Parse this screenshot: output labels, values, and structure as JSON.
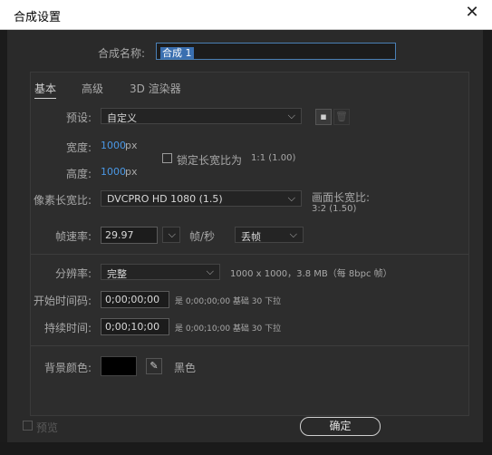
{
  "window": {
    "title": "合成设置"
  },
  "comp_name": {
    "label": "合成名称:",
    "value": "合成 1"
  },
  "tabs": [
    {
      "label": "基本",
      "active": true
    },
    {
      "label": "高级",
      "active": false
    },
    {
      "label": "3D 渲染器",
      "active": false
    }
  ],
  "preset": {
    "label": "预设:",
    "value": "自定义"
  },
  "width": {
    "label": "宽度:",
    "value": "1000",
    "unit": "px"
  },
  "height": {
    "label": "高度:",
    "value": "1000",
    "unit": "px"
  },
  "lock_aspect": {
    "label": "锁定长宽比为",
    "ratio": "1:1 (1.00)",
    "checked": false
  },
  "pixel_aspect": {
    "label": "像素长宽比:",
    "value": "DVCPRO HD 1080 (1.5)"
  },
  "frame_aspect": {
    "label": "画面长宽比:",
    "value": "3:2 (1.50)"
  },
  "frame_rate": {
    "label": "帧速率:",
    "value": "29.97",
    "unit": "帧/秒",
    "mode": "丢帧"
  },
  "resolution": {
    "label": "分辨率:",
    "value": "完整",
    "info": "1000 x 1000，3.8 MB（每 8bpc 帧）"
  },
  "start_timecode": {
    "label": "开始时间码:",
    "value": "0;00;00;00",
    "info": "是 0;00;00;00  基础 30  下拉"
  },
  "duration": {
    "label": "持续时间:",
    "value": "0;00;10;00",
    "info": "是 0;00;10;00  基础 30  下拉"
  },
  "bg_color": {
    "label": "背景颜色:",
    "name": "黑色",
    "color": "#000000"
  },
  "preview": {
    "label": "预览",
    "checked": false
  },
  "ok_button": {
    "label": "确定"
  },
  "colors": {
    "accent_blue": "#4a98e6",
    "dialog_bg": "#2a2a2a",
    "panel_bg": "#2d2d2d"
  }
}
